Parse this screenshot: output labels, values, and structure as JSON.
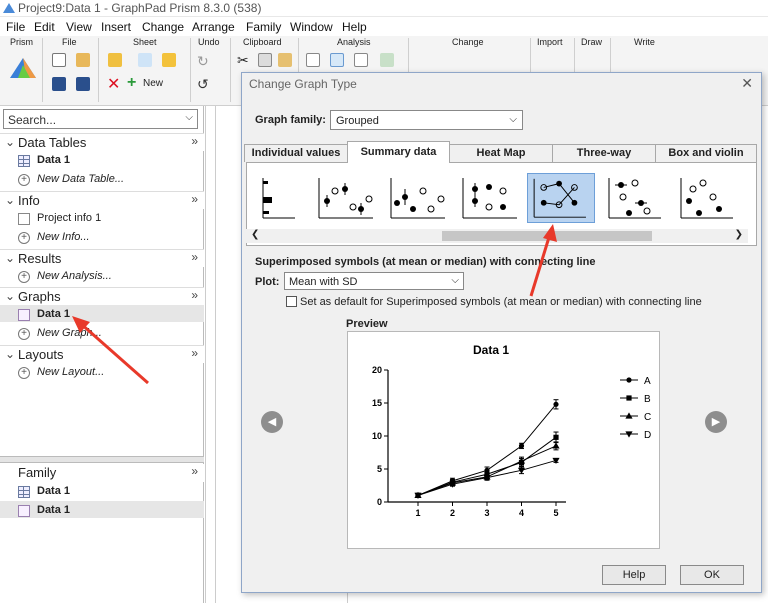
{
  "window": {
    "title": "Project9:Data 1 - GraphPad Prism 8.3.0 (538)"
  },
  "menu": [
    "File",
    "Edit",
    "View",
    "Insert",
    "Change",
    "Arrange",
    "Family",
    "Window",
    "Help"
  ],
  "ribbon": {
    "groups": [
      "Prism",
      "File",
      "Sheet",
      "Undo",
      "Clipboard",
      "Analysis",
      "Change",
      "Import",
      "Draw",
      "Write"
    ],
    "new_label": "New"
  },
  "sidebar": {
    "search_placeholder": "Search...",
    "sections": [
      {
        "title": "Data Tables",
        "items": [
          {
            "label": "Data 1"
          },
          {
            "label": "New Data Table..."
          }
        ]
      },
      {
        "title": "Info",
        "items": [
          {
            "label": "Project info 1"
          },
          {
            "label": "New Info..."
          }
        ]
      },
      {
        "title": "Results",
        "items": [
          {
            "label": "New Analysis..."
          }
        ]
      },
      {
        "title": "Graphs",
        "items": [
          {
            "label": "Data 1"
          },
          {
            "label": "New Graph..."
          }
        ]
      },
      {
        "title": "Layouts",
        "items": [
          {
            "label": "New Layout..."
          }
        ]
      }
    ],
    "family": {
      "title": "Family",
      "items": [
        {
          "label": "Data 1"
        },
        {
          "label": "Data 1"
        }
      ]
    }
  },
  "dialog": {
    "title": "Change Graph Type",
    "graph_family_label": "Graph family:",
    "graph_family_value": "Grouped",
    "tabs": [
      "Individual values",
      "Summary data",
      "Heat Map",
      "Three-way",
      "Box and violin"
    ],
    "active_tab": 1,
    "description": "Superimposed symbols (at mean or median) with connecting line",
    "plot_label": "Plot:",
    "plot_value": "Mean with SD",
    "checkbox_label": "Set as default for Superimposed symbols (at mean or median) with connecting line",
    "preview_label": "Preview",
    "help_label": "Help",
    "ok_label": "OK"
  },
  "chart_data": {
    "type": "line",
    "title": "Data 1",
    "x": [
      1,
      2,
      3,
      4,
      5
    ],
    "xlim": [
      1,
      5
    ],
    "ylim": [
      0,
      20
    ],
    "yticks": [
      0,
      5,
      10,
      15,
      20
    ],
    "legend_position": "right",
    "series": [
      {
        "name": "A",
        "marker": "circle",
        "values": [
          1.0,
          3.2,
          4.8,
          8.5,
          14.8
        ],
        "err": [
          0.3,
          0.4,
          0.5,
          0.4,
          0.7
        ]
      },
      {
        "name": "B",
        "marker": "square",
        "values": [
          1.0,
          3.0,
          4.2,
          6.0,
          9.8
        ],
        "err": [
          0.3,
          0.4,
          0.5,
          0.6,
          0.8
        ]
      },
      {
        "name": "C",
        "marker": "triangle-up",
        "values": [
          1.0,
          2.9,
          3.8,
          6.2,
          8.5
        ],
        "err": [
          0.3,
          0.4,
          0.4,
          0.6,
          0.6
        ]
      },
      {
        "name": "D",
        "marker": "triangle-down",
        "values": [
          1.0,
          2.7,
          3.7,
          4.8,
          6.3
        ],
        "err": [
          0.2,
          0.3,
          0.4,
          0.5,
          0.3
        ]
      }
    ]
  }
}
